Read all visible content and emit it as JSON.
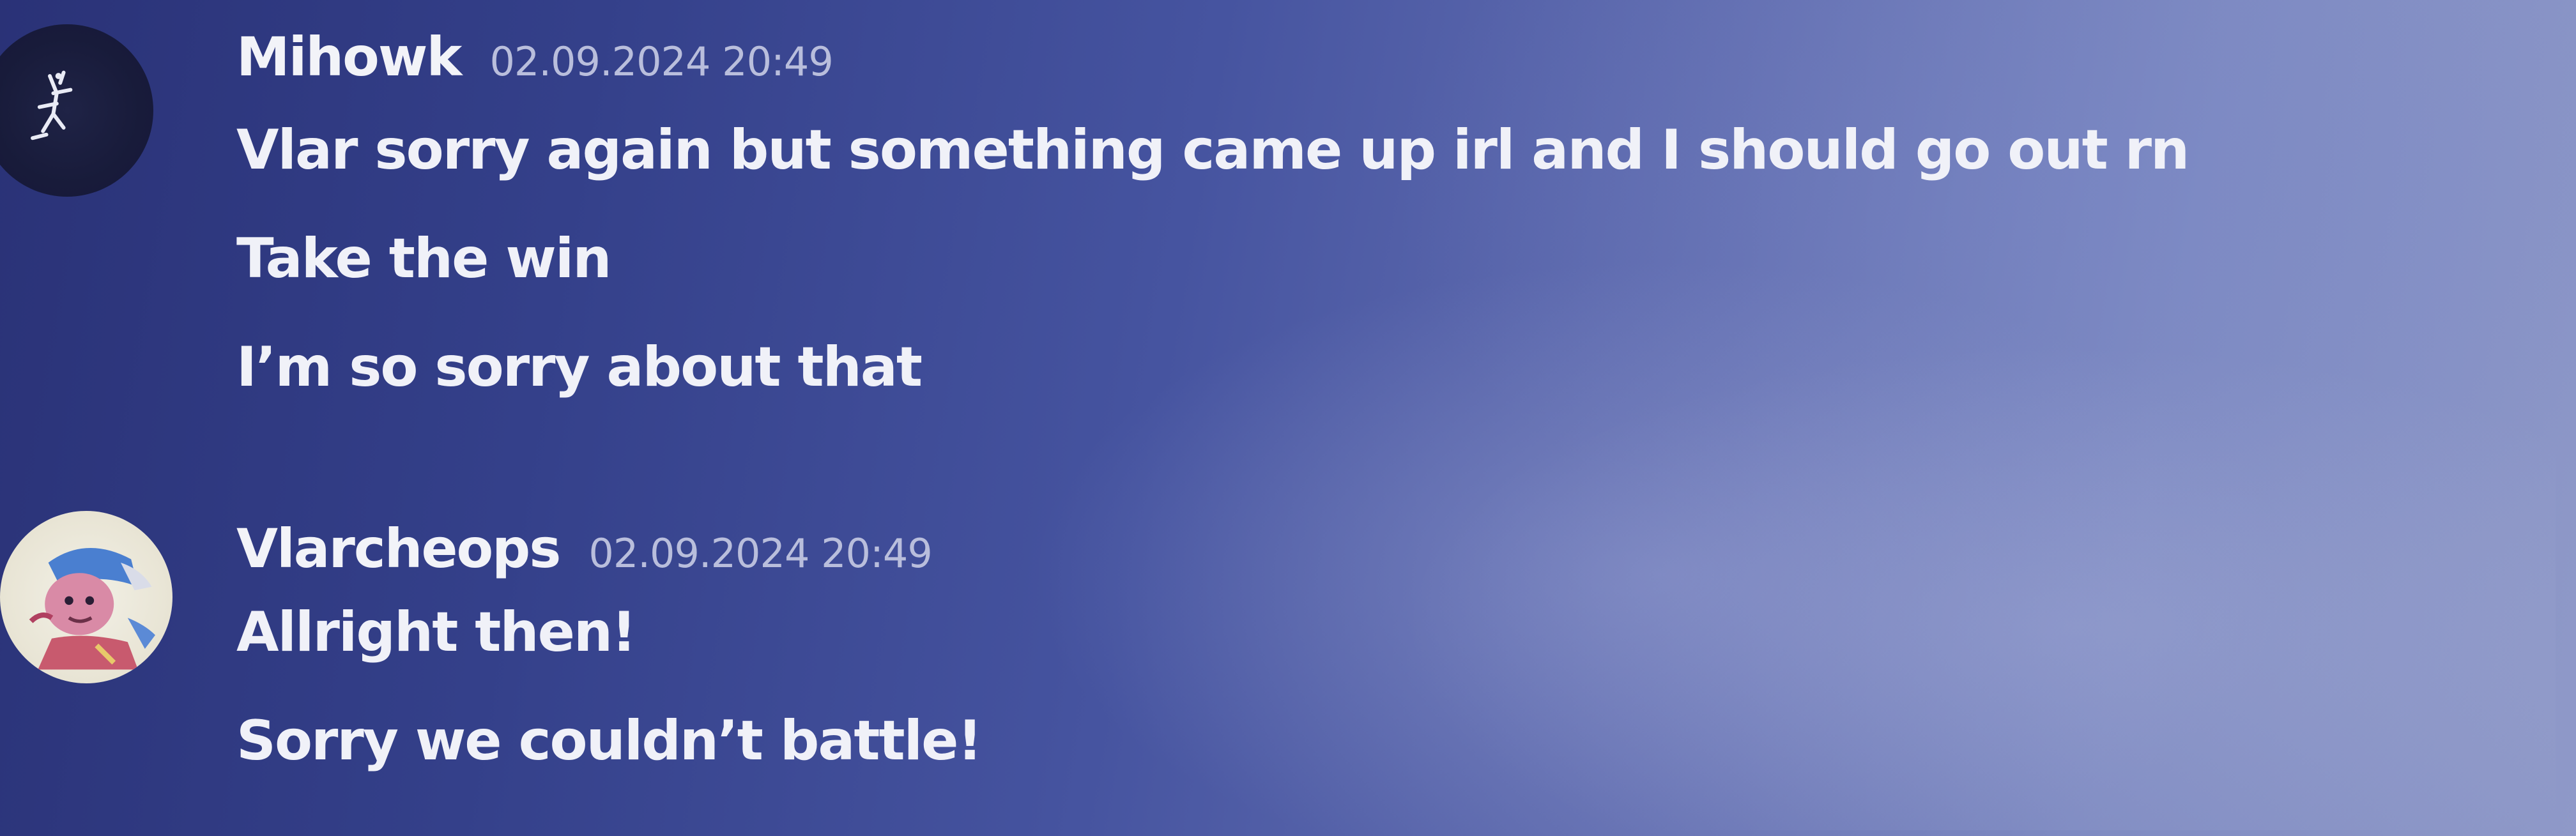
{
  "messages": [
    {
      "author": "Mihowk",
      "timestamp": "02.09.2024 20:49",
      "avatar_icon": "stickman-avatar",
      "lines": [
        "Vlar sorry again but something came up irl and I should go out rn",
        "Take the win",
        "I’m so sorry about that"
      ]
    },
    {
      "author": "Vlarcheops",
      "timestamp": "02.09.2024 20:49",
      "avatar_icon": "cartoon-character-avatar",
      "lines": [
        "Allright then!",
        "Sorry we couldn’t battle!"
      ]
    }
  ],
  "colors": {
    "background_dark": "#2a3277",
    "background_light": "#8f99c8",
    "username": "#f2f3f8",
    "timestamp": "#b9bedc",
    "message_text": "#f0f1f8"
  }
}
